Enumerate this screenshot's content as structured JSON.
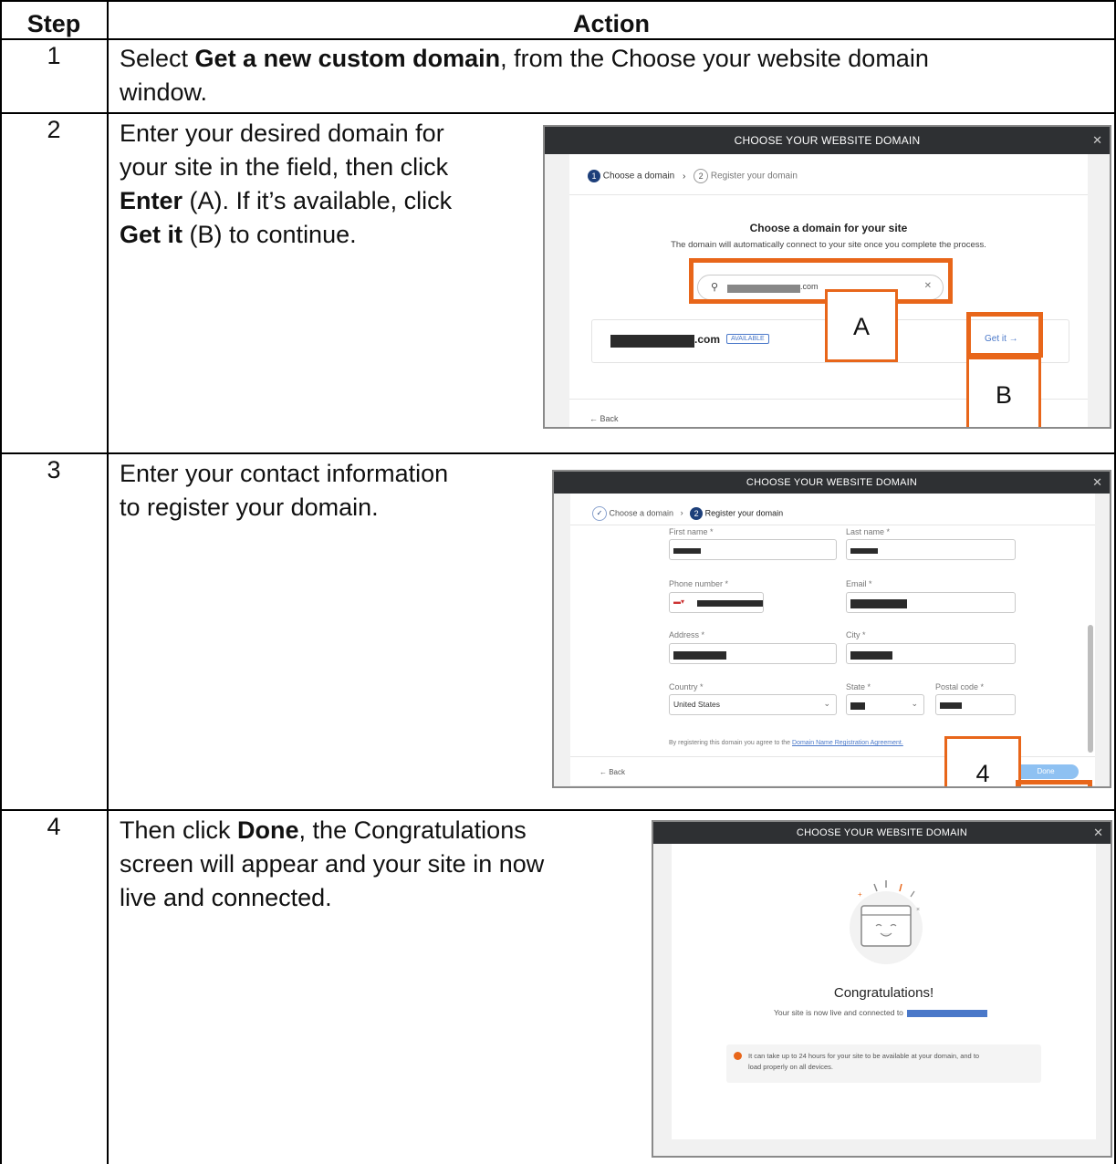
{
  "table": {
    "header_step": "Step",
    "header_action": "Action"
  },
  "rows": [
    {
      "step": "1",
      "line1_pre": "Select ",
      "line1_bold": "Get a new custom domain",
      "line1_post": ", from the Choose your website domain",
      "line2": "window."
    },
    {
      "step": "2",
      "line1": "Enter your desired domain for",
      "line2": "your site in the field, then click",
      "line3_bold": "Enter",
      "line3_post": " (A). If it’s available, click",
      "line4_bold": "Get it",
      "line4_post": " (B) to continue."
    },
    {
      "step": "3",
      "line1": "Enter your contact information",
      "line2": "to register your domain."
    },
    {
      "step": "4",
      "line1_pre": "Then click ",
      "line1_bold": "Done",
      "line1_post": ", the Congratulations",
      "line2": "screen will appear and your site in now",
      "line3": "live and connected."
    }
  ],
  "shot1": {
    "title": "CHOOSE YOUR WEBSITE DOMAIN",
    "step1_num": "1",
    "step1_label": "Choose a domain",
    "step2_num": "2",
    "step2_label": "Register your domain",
    "heading": "Choose a domain for your site",
    "subheading": "The domain will automatically connect to your site once you complete the process.",
    "search_suffix": ".com",
    "result_suffix": ".com",
    "available_badge": "AVAILABLE",
    "get_it": "Get it →",
    "back": "← Back",
    "callout_a": "A",
    "callout_b": "B"
  },
  "shot2": {
    "title": "CHOOSE YOUR WEBSITE DOMAIN",
    "step1_label": "Choose a domain",
    "step2_num": "2",
    "step2_label": "Register your domain",
    "first_name": "First name *",
    "last_name": "Last name *",
    "phone": "Phone number *",
    "email": "Email *",
    "address": "Address *",
    "city": "City *",
    "country": "Country *",
    "country_value": "United States",
    "state": "State *",
    "postal": "Postal code *",
    "agree_pre": "By registering this domain you agree to the ",
    "agree_link": "Domain Name Registration Agreement.",
    "back": "← Back",
    "done": "Done",
    "callout_4": "4"
  },
  "shot3": {
    "title": "CHOOSE YOUR WEBSITE DOMAIN",
    "heading": "Congratulations!",
    "subtext": "Your site is now live and connected to",
    "notice_line1": "It can take up to 24 hours for your site to be available at your domain, and to",
    "notice_line2": "load properly on all devices."
  },
  "colors": {
    "callout_orange": "#e8661a",
    "titlebar": "#2e3033",
    "step_blue": "#1d3f7a",
    "link_blue": "#4a78c9",
    "done_button": "#8ec1f2"
  }
}
